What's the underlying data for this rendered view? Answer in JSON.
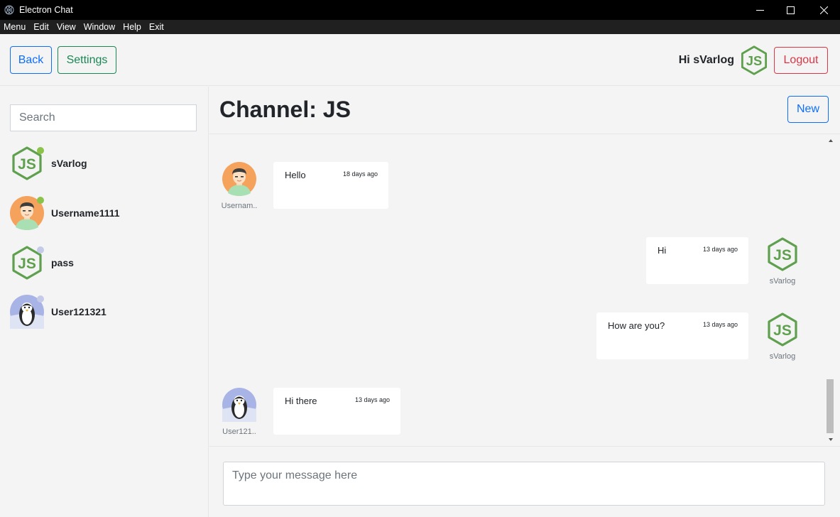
{
  "window": {
    "title": "Electron Chat"
  },
  "menu": [
    "Menu",
    "Edit",
    "View",
    "Window",
    "Help",
    "Exit"
  ],
  "header": {
    "back_label": "Back",
    "settings_label": "Settings",
    "greeting": "Hi sVarlog",
    "logout_label": "Logout"
  },
  "sidebar": {
    "search_placeholder": "Search",
    "users": [
      {
        "name": "sVarlog",
        "avatar": "nodejs-logo",
        "online": true
      },
      {
        "name": "Username1111",
        "avatar": "man-avatar",
        "online": true
      },
      {
        "name": "pass",
        "avatar": "nodejs-logo",
        "online": false
      },
      {
        "name": "User121321",
        "avatar": "penguin-avatar",
        "online": false
      }
    ]
  },
  "channel": {
    "title": "Channel: JS",
    "new_label": "New"
  },
  "messages": [
    {
      "text": "Hello",
      "time": "18 days ago",
      "sender": "Usernam..",
      "avatar": "man-avatar",
      "own": false
    },
    {
      "text": "Hi",
      "time": "13 days ago",
      "sender": "sVarlog",
      "avatar": "nodejs-logo",
      "own": true
    },
    {
      "text": "How are you?",
      "time": "13 days ago",
      "sender": "sVarlog",
      "avatar": "nodejs-logo",
      "own": true
    },
    {
      "text": "Hi there",
      "time": "13 days ago",
      "sender": "User121..",
      "avatar": "penguin-avatar",
      "own": false
    }
  ],
  "composer": {
    "placeholder": "Type your message here"
  },
  "colors": {
    "primary": "#0d6efd",
    "success": "#198754",
    "danger": "#dc3545",
    "online": "#8bc34a",
    "offline": "#c5cae9",
    "node_green": "#5fa04e"
  }
}
